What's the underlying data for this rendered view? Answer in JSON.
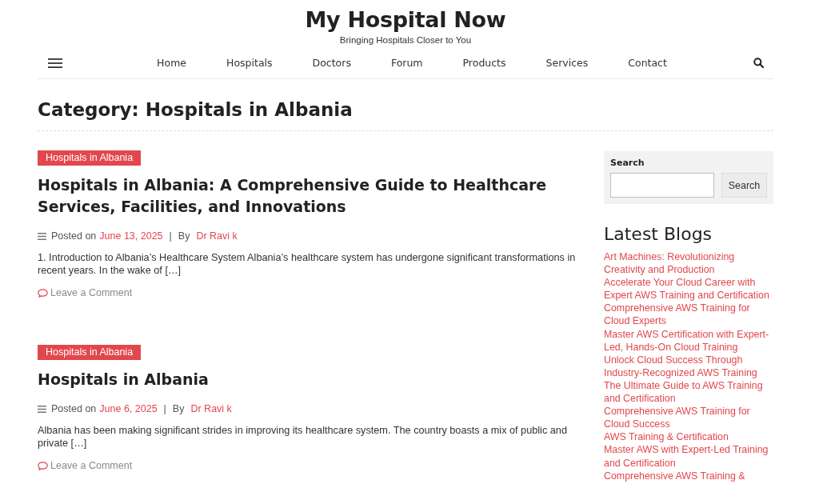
{
  "site": {
    "title": "My Hospital Now",
    "tagline": "Bringing Hospitals Closer to You"
  },
  "nav": {
    "items": [
      "Home",
      "Hospitals",
      "Doctors",
      "Forum",
      "Products",
      "Services",
      "Contact"
    ]
  },
  "page_title": "Category: Hospitals in Albania",
  "posts": [
    {
      "category": "Hospitals in Albania",
      "title": "Hospitals in Albania: A Comprehensive Guide to Healthcare Services, Facilities, and Innovations",
      "posted_label": "Posted on",
      "date": "June 13, 2025",
      "separator": "|",
      "by_label": "By",
      "author": "Dr Ravi k",
      "excerpt": "1. Introduction to Albania’s Healthcare System Albania’s healthcare system has undergone significant transformations in recent years. In the wake of […]",
      "comment_link": "Leave a Comment"
    },
    {
      "category": "Hospitals in Albania",
      "title": "Hospitals in Albania",
      "posted_label": "Posted on",
      "date": "June 6, 2025",
      "separator": "|",
      "by_label": "By",
      "author": "Dr Ravi k",
      "excerpt": "Albania has been making significant strides in improving its healthcare system. The country boasts a mix of public and private […]",
      "comment_link": "Leave a Comment"
    }
  ],
  "sidebar": {
    "search": {
      "label": "Search",
      "button": "Search"
    },
    "latest_blogs": {
      "title": "Latest Blogs",
      "links": [
        "Art Machines: Revolutionizing Creativity and Production",
        "Accelerate Your Cloud Career with Expert AWS Training and Certification",
        "Comprehensive AWS Training for Cloud Experts",
        "Master AWS Certification with Expert-Led, Hands-On Cloud Training",
        "Unlock Cloud Success Through Industry-Recognized AWS Training",
        "The Ultimate Guide to AWS Training and Certification",
        "Comprehensive AWS Training for Cloud Success",
        "AWS Training & Certification",
        "Master AWS with Expert-Led Training and Certification",
        "Comprehensive AWS Training &"
      ]
    }
  }
}
